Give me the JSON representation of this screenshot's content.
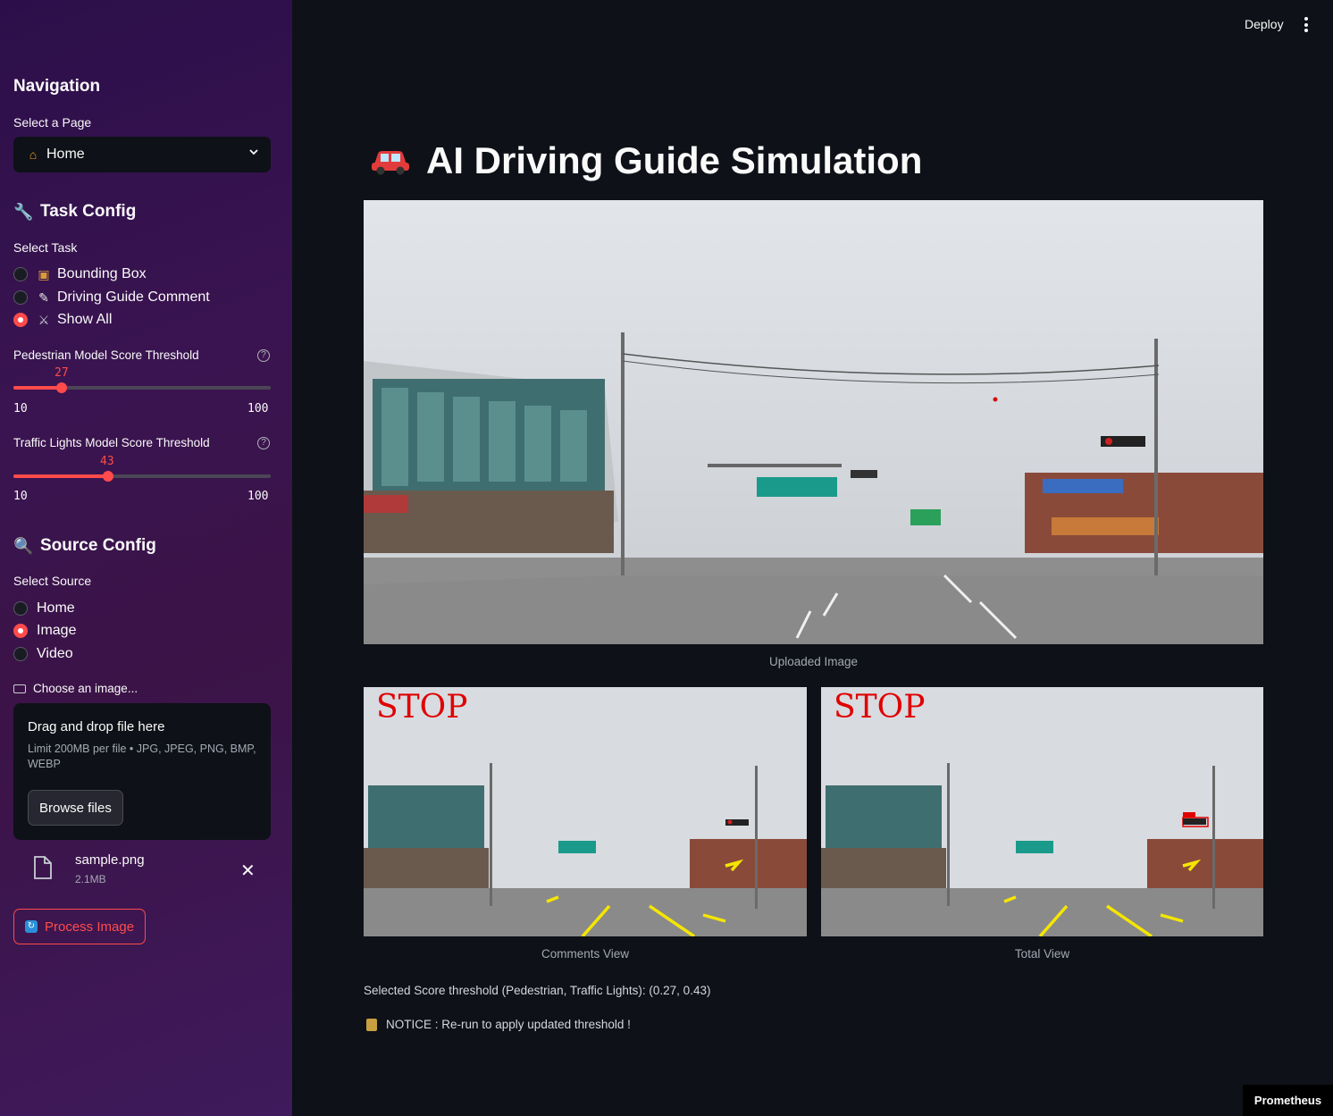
{
  "header": {
    "deploy_label": "Deploy"
  },
  "sidebar": {
    "nav_title": "Navigation",
    "select_page_label": "Select a Page",
    "select_page_value": "Home",
    "task_config_title": "Task Config",
    "select_task_label": "Select Task",
    "tasks": [
      {
        "label": "Bounding Box",
        "selected": false
      },
      {
        "label": "Driving Guide Comment",
        "selected": false
      },
      {
        "label": "Show All",
        "selected": true
      }
    ],
    "ped_slider": {
      "label": "Pedestrian Model Score Threshold",
      "value": "27",
      "min": "10",
      "max": "100"
    },
    "tl_slider": {
      "label": "Traffic Lights Model Score Threshold",
      "value": "43",
      "min": "10",
      "max": "100"
    },
    "source_config_title": "Source Config",
    "select_source_label": "Select Source",
    "sources": [
      {
        "label": "Home",
        "selected": false
      },
      {
        "label": "Image",
        "selected": true
      },
      {
        "label": "Video",
        "selected": false
      }
    ],
    "uploader_label": "Choose an image...",
    "dropzone_title": "Drag and drop file here",
    "dropzone_limit": "Limit 200MB per file • JPG, JPEG, PNG, BMP, WEBP",
    "browse_label": "Browse files",
    "file_name": "sample.png",
    "file_size": "2.1MB",
    "process_label": "Process Image"
  },
  "main": {
    "title": "AI Driving Guide Simulation",
    "uploaded_caption": "Uploaded Image",
    "comments_caption": "Comments View",
    "total_caption": "Total View",
    "overlay_text": "STOP",
    "threshold_text": "Selected Score threshold (Pedestrian, Traffic Lights): (0.27, 0.43)",
    "notice_text": "NOTICE : Re-run to apply updated threshold !"
  },
  "badge": {
    "label": "Prometheus"
  },
  "colors": {
    "accent": "#ff4b4b",
    "background": "#0e1117",
    "sidebar": "#3a1450"
  }
}
